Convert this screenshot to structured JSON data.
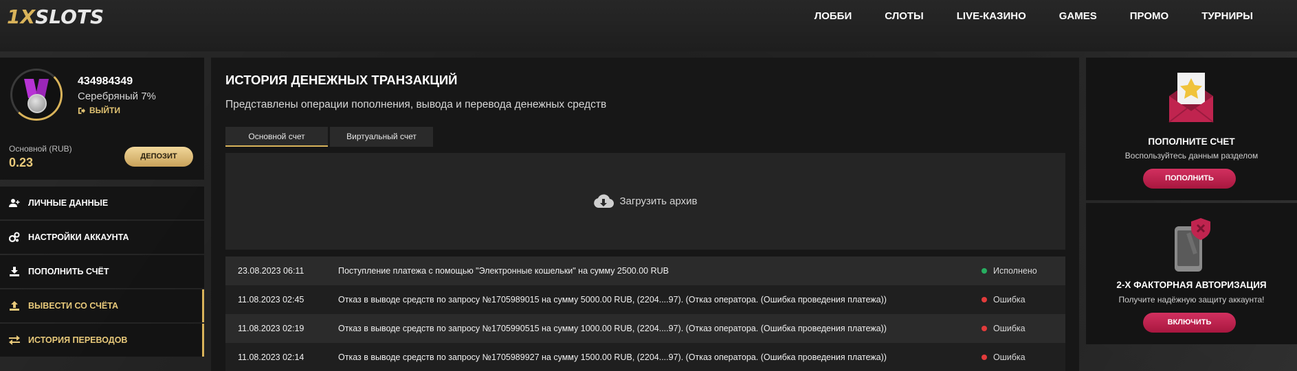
{
  "header": {
    "logo": {
      "one": "1",
      "x": "X",
      "rest": "SLOTS"
    },
    "nav": [
      "ЛОББИ",
      "СЛОТЫ",
      "LIVE-КАЗИНО",
      "GAMES",
      "ПРОМО",
      "ТУРНИРЫ"
    ]
  },
  "profile": {
    "user_id": "434984349",
    "level": "Серебряный 7%",
    "logout_label": "ВЫЙТИ",
    "balance_label": "Основной (RUB)",
    "balance_value": "0.23",
    "deposit_label": "ДЕПОЗИТ"
  },
  "menu": {
    "items": [
      {
        "label": "ЛИЧНЫЕ ДАННЫЕ",
        "icon": "user-plus-icon"
      },
      {
        "label": "НАСТРОЙКИ АККАУНТА",
        "icon": "gears-icon"
      },
      {
        "label": "ПОПОЛНИТЬ СЧЁТ",
        "icon": "download-icon"
      },
      {
        "label": "ВЫВЕСТИ СО СЧЁТА",
        "icon": "upload-icon"
      },
      {
        "label": "ИСТОРИЯ ПЕРЕВОДОВ",
        "icon": "transfer-icon"
      }
    ]
  },
  "main": {
    "title": "ИСТОРИЯ ДЕНЕЖНЫХ ТРАНЗАКЦИЙ",
    "subtitle": "Представлены операции пополнения, вывода и перевода денежных средств",
    "tabs": [
      "Основной счет",
      "Виртуальный счет"
    ],
    "archive_label": "Загрузить архив",
    "transactions": [
      {
        "date": "23.08.2023 06:11",
        "desc": "Поступление платежа с помощью \"Электронные кошельки\" на сумму 2500.00 RUB",
        "status": "Исполнено",
        "status_color": "#27ae60"
      },
      {
        "date": "11.08.2023 02:45",
        "desc": "Отказ в выводе средств по запросу №1705989015 на сумму 5000.00 RUB, (2204....97). (Отказ оператора. (Ошибка проведения платежа))",
        "status": "Ошибка",
        "status_color": "#e23b3b"
      },
      {
        "date": "11.08.2023 02:19",
        "desc": "Отказ в выводе средств по запросу №1705990515 на сумму 1000.00 RUB, (2204....97). (Отказ оператора. (Ошибка проведения платежа))",
        "status": "Ошибка",
        "status_color": "#e23b3b"
      },
      {
        "date": "11.08.2023 02:14",
        "desc": "Отказ в выводе средств по запросу №1705989927 на сумму 1500.00 RUB, (2204....97). (Отказ оператора. (Ошибка проведения платежа))",
        "status": "Ошибка",
        "status_color": "#e23b3b"
      }
    ]
  },
  "right": {
    "deposit_card": {
      "title": "ПОПОЛНИТЕ СЧЕТ",
      "desc": "Воспользуйтесь данным разделом",
      "button": "ПОПОЛНИТЬ"
    },
    "twofa_card": {
      "title": "2-Х ФАКТОРНАЯ АВТОРИЗАЦИЯ",
      "desc": "Получите надёжную защиту аккаунта!",
      "button": "ВКЛЮЧИТЬ"
    }
  },
  "colors": {
    "gold": "#d9b35a",
    "accent_red": "#c0244f",
    "success": "#27ae60",
    "error": "#e23b3b"
  }
}
